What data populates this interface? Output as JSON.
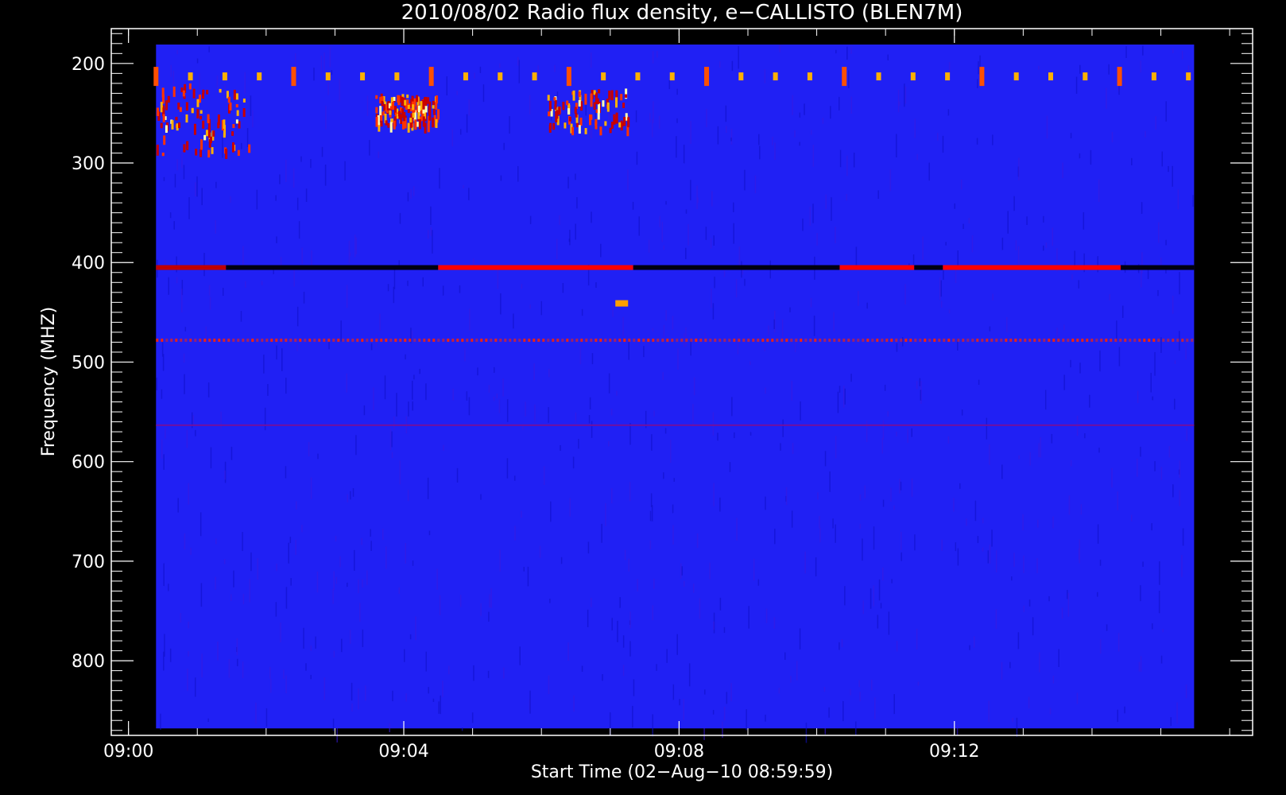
{
  "chart_data": {
    "type": "heatmap",
    "title": "2010/08/02  Radio flux density, e−CALLISTO (BLEN7M)",
    "xlabel": "Start Time (02−Aug−10 08:59:59)",
    "ylabel": "Frequency (MHZ)",
    "x_unit": "time (UT, 02-Aug-2010)",
    "y_unit": "MHz",
    "xlim": [
      "08:59:45",
      "09:16:20"
    ],
    "ylim": [
      875,
      165
    ],
    "data_xlim": [
      "09:00:24",
      "09:15:29"
    ],
    "data_ylim": [
      868,
      181
    ],
    "x_ticks": [
      "09:00",
      "09:04",
      "09:08",
      "09:12"
    ],
    "y_ticks": [
      200,
      300,
      400,
      500,
      600,
      700,
      800
    ],
    "colormap": [
      "#000000",
      "#1414ff",
      "#c80000",
      "#ff3300",
      "#ffb000",
      "#ffffb0"
    ],
    "background_level": "#2020f4",
    "features": [
      {
        "label": "periodic interference",
        "freq_mhz": 213,
        "start": "09:00:24",
        "end": "09:15:29",
        "period_s": 120,
        "intensity": "high"
      },
      {
        "label": "burst cluster",
        "freq_mhz": [
          220,
          290
        ],
        "start": "09:00:24",
        "end": "09:01:45",
        "intensity": "high"
      },
      {
        "label": "burst cluster",
        "freq_mhz": [
          230,
          260
        ],
        "start": "09:03:35",
        "end": "09:04:30",
        "intensity": "very high"
      },
      {
        "label": "burst cluster",
        "freq_mhz": [
          225,
          265
        ],
        "start": "09:06:05",
        "end": "09:07:15",
        "intensity": "high"
      },
      {
        "label": "band",
        "freq_mhz": 405,
        "start": "09:00:24",
        "end": "09:01:25",
        "color": "#c00000"
      },
      {
        "label": "band",
        "freq_mhz": 405,
        "start": "09:01:25",
        "end": "09:04:30",
        "color": "#000010"
      },
      {
        "label": "band",
        "freq_mhz": 405,
        "start": "09:04:30",
        "end": "09:07:20",
        "color": "#ff0000"
      },
      {
        "label": "band",
        "freq_mhz": 405,
        "start": "09:07:20",
        "end": "09:10:20",
        "color": "#000010"
      },
      {
        "label": "band",
        "freq_mhz": 405,
        "start": "09:10:20",
        "end": "09:11:25",
        "color": "#ff0000"
      },
      {
        "label": "band",
        "freq_mhz": 405,
        "start": "09:11:25",
        "end": "09:11:50",
        "color": "#000010"
      },
      {
        "label": "band",
        "freq_mhz": 405,
        "start": "09:11:50",
        "end": "09:14:25",
        "color": "#ff0000"
      },
      {
        "label": "band",
        "freq_mhz": 405,
        "start": "09:14:25",
        "end": "09:15:29",
        "color": "#000010"
      },
      {
        "label": "spot",
        "freq_mhz": 441,
        "time": "09:07:10",
        "color": "#ffa000"
      },
      {
        "label": "dashed line",
        "freq_mhz": 478,
        "start": "09:00:24",
        "end": "09:15:29",
        "color": "#ff2200"
      },
      {
        "label": "faint line",
        "freq_mhz": 565,
        "start": "09:00:24",
        "end": "09:15:29",
        "color": "#7010a0"
      }
    ]
  }
}
